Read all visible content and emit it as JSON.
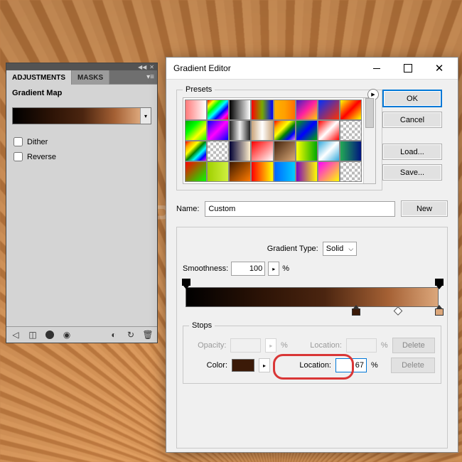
{
  "watermark": "WWW.PSD-DUDE.COM",
  "adjustments": {
    "tab_adjustments": "ADJUSTMENTS",
    "tab_masks": "MASKS",
    "subtitle": "Gradient Map",
    "dither_label": "Dither",
    "reverse_label": "Reverse"
  },
  "dialog": {
    "title": "Gradient Editor",
    "presets_legend": "Presets",
    "ok": "OK",
    "cancel": "Cancel",
    "load": "Load...",
    "save": "Save...",
    "name_label": "Name:",
    "name_value": "Custom",
    "new": "New",
    "gtype_label": "Gradient Type:",
    "gtype_value": "Solid",
    "smoothness_label": "Smoothness:",
    "smoothness_value": "100",
    "pct": "%",
    "stops_legend": "Stops",
    "opacity_label": "Opacity:",
    "location_label": "Location:",
    "location_value": "67",
    "color_label": "Color:",
    "delete": "Delete",
    "color_swatch": "#3b1a08",
    "swatches": [
      "linear-gradient(to right,#ff7a7a,#fff)",
      "linear-gradient(135deg,red,yellow,lime,cyan,blue,magenta,red)",
      "linear-gradient(to right,#000,#fff)",
      "linear-gradient(to right,red,#7a0,#00f)",
      "linear-gradient(to right,#ffb000,#ffa000,#ff7000)",
      "linear-gradient(135deg,#4020c0,#ff20a0,#ffd000)",
      "linear-gradient(135deg,#0030ff,#ff3000)",
      "linear-gradient(135deg,#ff0,#f00,#ff0)",
      "linear-gradient(135deg,#0a0,#0f0,#ff0,#0f0)",
      "linear-gradient(135deg,#00f,#f0f,#00f)",
      "linear-gradient(to right,#222,#eee,#222)",
      "linear-gradient(to right,#caa47a,#fff,#caa47a)",
      "linear-gradient(135deg,red,orange,yellow,green,blue,violet)",
      "linear-gradient(135deg,#0a0,#00f,#0a0)",
      "linear-gradient(135deg,#f00,#fff,#f00)",
      "repeating-conic-gradient(#bbb 0 25%,#fff 0 50%) 0/8px 8px",
      "linear-gradient(135deg,red,orange,yellow,green,cyan,blue,magenta)",
      "repeating-conic-gradient(#bbb 0 25%,#fff 0 50%) 0/8px 8px",
      "linear-gradient(to right,#003,#ffeecc)",
      "linear-gradient(to bottom right,#f00,#fff)",
      "linear-gradient(135deg,#42210b,#d8a878)",
      "linear-gradient(to right,#ff0,#0a0)",
      "linear-gradient(135deg,#3ad,#fff,#3ad)",
      "linear-gradient(to right,#2a5,#001480)",
      "linear-gradient(135deg,#f00,#0f0)",
      "linear-gradient(to right,#a0d000,#d0f040)",
      "linear-gradient(135deg,#3d1a00,#ff7b00)",
      "linear-gradient(to right,#f00,#ff0)",
      "linear-gradient(to right,#06f,#0cf)",
      "linear-gradient(to right,#8000c0,#ff0)",
      "linear-gradient(135deg,#f0f,#ff0)",
      "repeating-conic-gradient(#bbb 0 25%,#fff 0 50%) 0/8px 8px"
    ]
  }
}
